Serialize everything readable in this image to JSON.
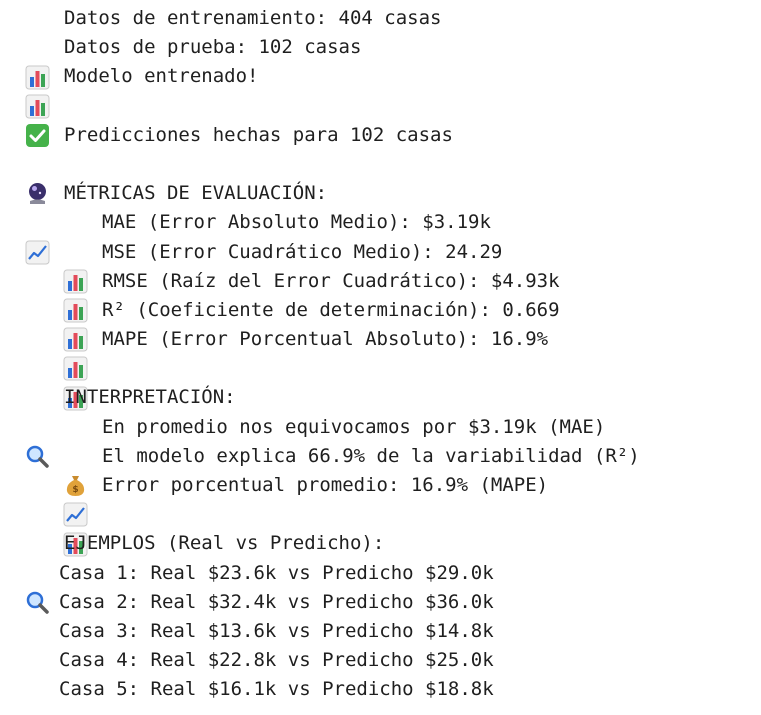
{
  "lines": {
    "train": "Datos de entrenamiento: 404 casas",
    "test": "Datos de prueba: 102 casas",
    "trained": "Modelo entrenado!",
    "predictions": "Predicciones hechas para 102 casas",
    "metrics_header": "MÉTRICAS DE EVALUACIÓN:",
    "mae": "MAE (Error Absoluto Medio): $3.19k",
    "mse": "MSE (Error Cuadrático Medio): 24.29",
    "rmse": "RMSE (Raíz del Error Cuadrático): $4.93k",
    "r2": "R² (Coeficiente de determinación): 0.669",
    "mape": "MAPE (Error Porcentual Absoluto): 16.9%",
    "interp_header": "INTERPRETACIÓN:",
    "interp_mae": "En promedio nos equivocamos por $3.19k (MAE)",
    "interp_r2": "El modelo explica 66.9% de la variabilidad (R²)",
    "interp_mape": "Error porcentual promedio: 16.9% (MAPE)",
    "examples_header": "EJEMPLOS (Real vs Predicho):"
  },
  "examples": [
    "Casa 1: Real $23.6k vs Predicho $29.0k",
    "Casa 2: Real $32.4k vs Predicho $36.0k",
    "Casa 3: Real $13.6k vs Predicho $14.8k",
    "Casa 4: Real $22.8k vs Predicho $25.0k",
    "Casa 5: Real $16.1k vs Predicho $18.8k"
  ],
  "icons": {
    "bar_chart": "bar-chart-icon",
    "check": "check-mark-icon",
    "crystal_ball": "crystal-ball-icon",
    "trend": "chart-increasing-icon",
    "magnifier": "magnifying-glass-icon",
    "money_bag": "money-bag-icon"
  },
  "colors": {
    "text": "#1f1f1f",
    "check_green": "#45b24a",
    "bar_blue": "#2e6fd6",
    "bar_red": "#e34b5a",
    "bar_green": "#3ca455"
  }
}
